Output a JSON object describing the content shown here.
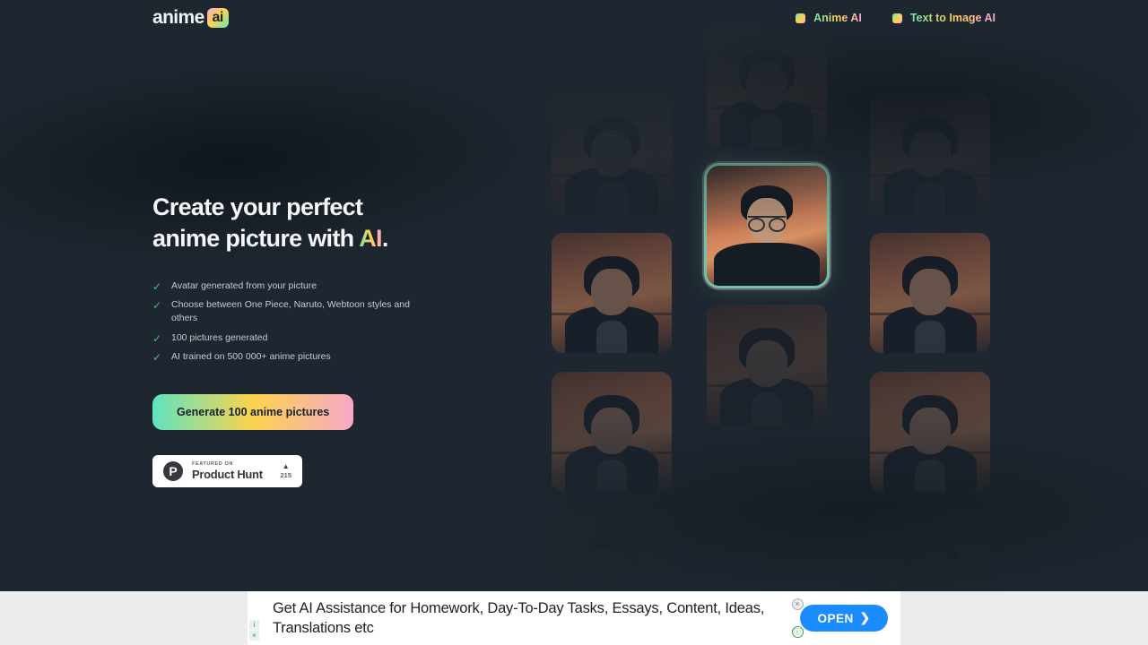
{
  "header": {
    "logo_word": "anime",
    "logo_badge": "ai",
    "nav": [
      {
        "label": "Anime AI",
        "icon": "gradient-square-icon"
      },
      {
        "label": "Text to Image AI",
        "icon": "gradient-square-icon"
      }
    ]
  },
  "hero": {
    "headline_line1": "Create your perfect",
    "headline_line2_pre": "anime picture with ",
    "headline_accent": "AI",
    "headline_period": ".",
    "features": [
      "Avatar generated from your picture",
      "Choose between One Piece, Naruto, Webtoon styles and others",
      "100 pictures generated",
      "AI trained on 500 000+ anime pictures"
    ],
    "cta_label": "Generate 100 anime pictures",
    "product_hunt": {
      "featured_on": "FEATURED ON",
      "name": "Product Hunt",
      "arrow": "▲",
      "count": "215",
      "logo_letter": "P"
    }
  },
  "carousel": {
    "prev_icon": "‹",
    "next_icon": "›"
  },
  "gallery": {
    "columns": [
      {
        "tiles": [
          {
            "state": "faded2",
            "alt": "anime portrait"
          },
          {
            "state": "normal",
            "alt": "anime portrait"
          },
          {
            "state": "normal",
            "alt": "anime portrait"
          },
          {
            "state": "faded2",
            "alt": "anime portrait"
          }
        ]
      },
      {
        "tiles": [
          {
            "state": "faded",
            "alt": "anime portrait"
          },
          {
            "state": "highlight",
            "alt": "source photo of man with glasses"
          },
          {
            "state": "faded",
            "alt": "anime portrait"
          }
        ]
      },
      {
        "tiles": [
          {
            "state": "faded2",
            "alt": "anime portrait"
          },
          {
            "state": "normal",
            "alt": "anime portrait"
          },
          {
            "state": "normal",
            "alt": "anime portrait"
          },
          {
            "state": "faded2",
            "alt": "anime portrait"
          }
        ]
      }
    ]
  },
  "ad": {
    "text": "Get AI Assistance for Homework, Day-To-Day Tasks, Essays, Content, Ideas, Translations etc",
    "open_label": "OPEN",
    "open_arrow": "❯",
    "info_badge": "i",
    "close_badge": "×",
    "close_circle": "×",
    "adchoices": "ⓘ"
  },
  "colors": {
    "background": "#1e2730",
    "accent_green": "#6ee7b7",
    "accent_yellow": "#fcd34d",
    "accent_pink": "#f9a8d4",
    "ad_blue": "#1a8cff",
    "check_green": "#3fbf9a"
  }
}
